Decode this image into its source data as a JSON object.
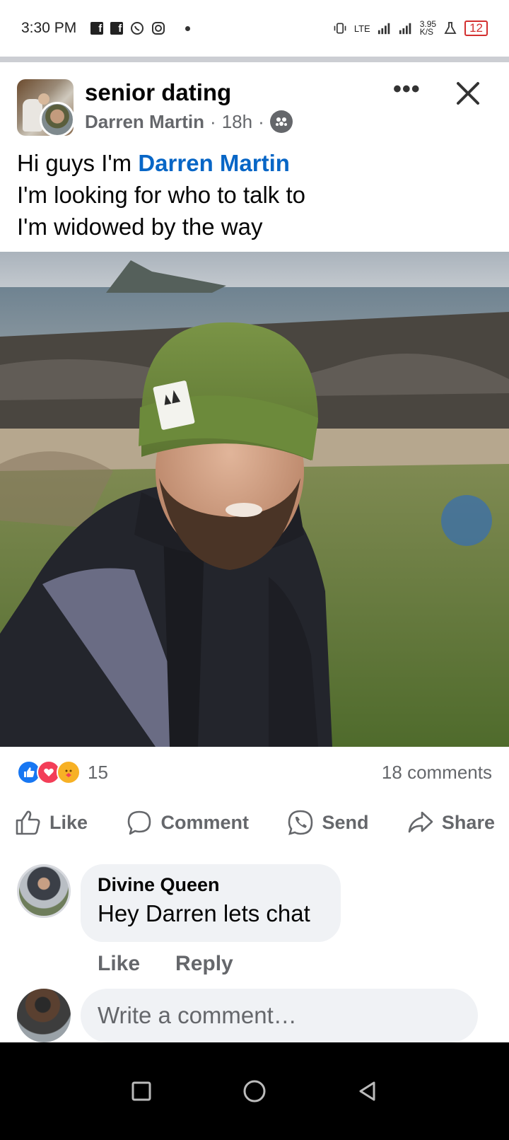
{
  "status_bar": {
    "time": "3:30 PM",
    "network": "LTE",
    "speed": "3.95",
    "speed_unit": "K/S",
    "battery": "12"
  },
  "post": {
    "group_name": "senior dating",
    "author": "Darren Martin",
    "time": "18h",
    "text_line1_prefix": "Hi guys I'm ",
    "text_mention": "Darren Martin",
    "text_line2": "I'm looking for who to talk to",
    "text_line3": "I'm widowed by the way",
    "reaction_count": "15",
    "comments_count": "18 comments"
  },
  "actions": {
    "like": "Like",
    "comment": "Comment",
    "send": "Send",
    "share": "Share"
  },
  "comment": {
    "name": "Divine Queen",
    "text": "Hey Darren lets chat",
    "like": "Like",
    "reply": "Reply"
  },
  "write_comment": {
    "placeholder": "Write a comment…"
  },
  "colors": {
    "accent": "#0866c6",
    "like_blue": "#1877f2",
    "love_red": "#f33e58",
    "muted": "#65676b"
  }
}
